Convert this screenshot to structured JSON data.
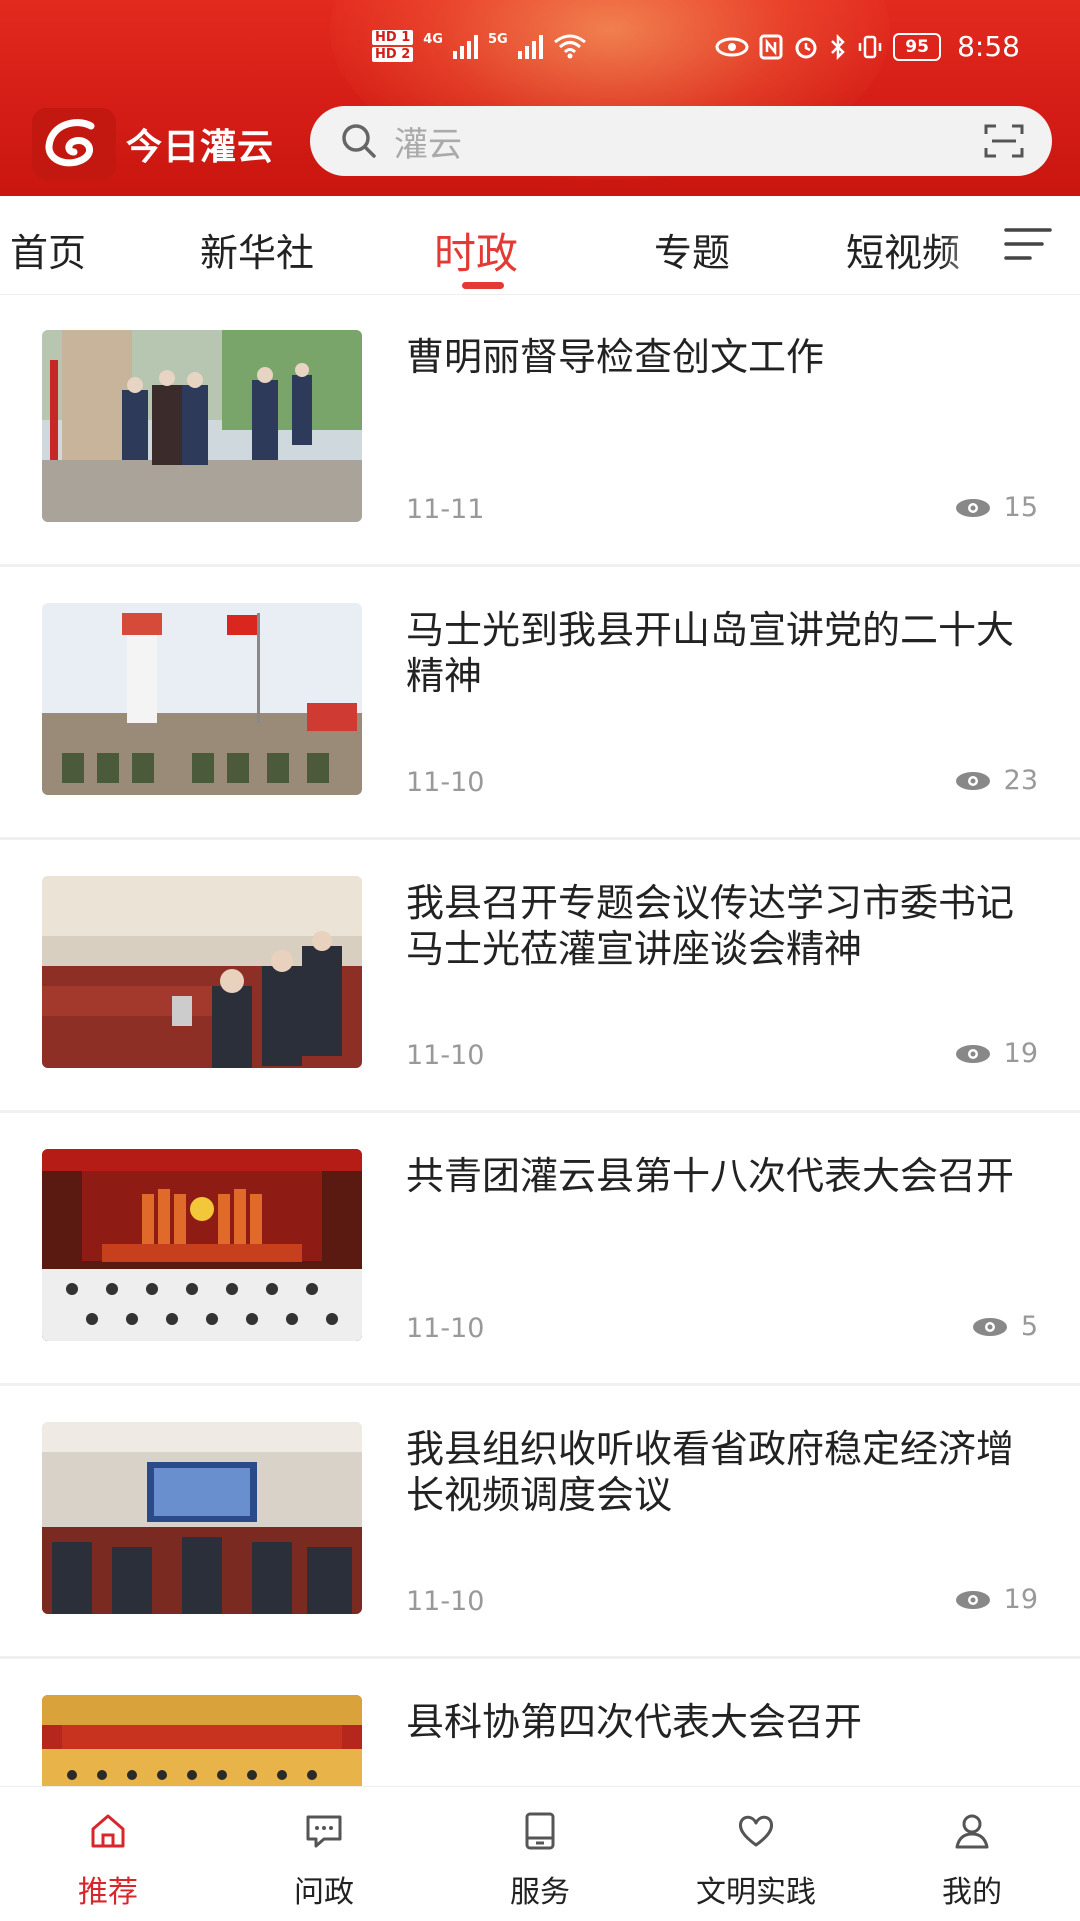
{
  "status_bar": {
    "left_label_1": "HD 1",
    "left_label_2": "HD 2",
    "net_1": "4G",
    "net_2": "5G",
    "battery": "95",
    "time": "8:58"
  },
  "header": {
    "app_title": "今日灌云",
    "search_placeholder": "灌云"
  },
  "tabs": [
    {
      "label": "首页"
    },
    {
      "label": "新华社"
    },
    {
      "label": "时政",
      "active": true
    },
    {
      "label": "专题"
    },
    {
      "label": "短视频"
    }
  ],
  "news": [
    {
      "title": "曹明丽督导检查创文工作",
      "date": "11-11",
      "views": "15"
    },
    {
      "title": "马士光到我县开山岛宣讲党的二十大精神",
      "date": "11-10",
      "views": "23"
    },
    {
      "title": "我县召开专题会议传达学习市委书记马士光莅灌宣讲座谈会精神",
      "date": "11-10",
      "views": "19"
    },
    {
      "title": "共青团灌云县第十八次代表大会召开",
      "date": "11-10",
      "views": "5"
    },
    {
      "title": "我县组织收听收看省政府稳定经济增长视频调度会议",
      "date": "11-10",
      "views": "19"
    },
    {
      "title": "县科协第四次代表大会召开",
      "date": "",
      "views": ""
    }
  ],
  "bottom_nav": [
    {
      "label": "推荐",
      "icon": "home-icon",
      "active": true
    },
    {
      "label": "问政",
      "icon": "chat-icon"
    },
    {
      "label": "服务",
      "icon": "tablet-icon"
    },
    {
      "label": "文明实践",
      "icon": "heart-icon"
    },
    {
      "label": "我的",
      "icon": "user-icon"
    }
  ],
  "colors": {
    "brand_red": "#d41d16",
    "active_tab": "#e33a35",
    "nav_active": "#d8262b"
  }
}
